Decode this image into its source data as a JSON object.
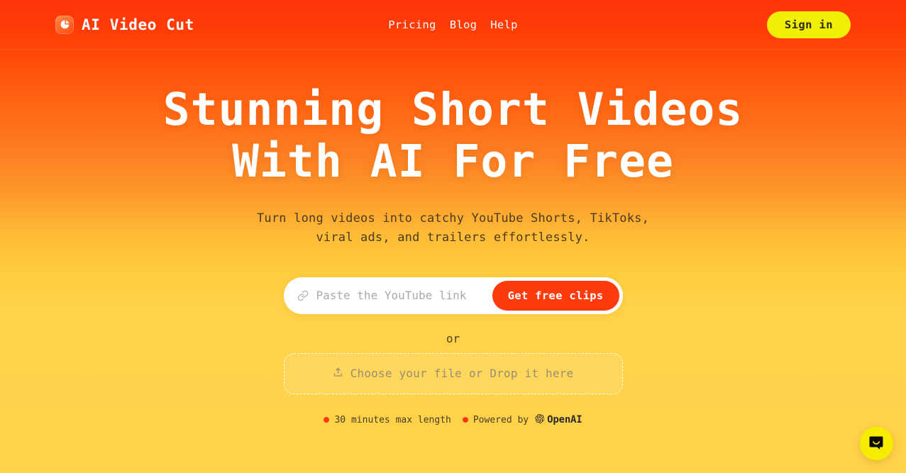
{
  "brand": {
    "name": "AI Video Cut",
    "logo_icon": "pie-chart-logo-icon"
  },
  "nav": {
    "items": [
      {
        "label": "Pricing"
      },
      {
        "label": "Blog"
      },
      {
        "label": "Help"
      }
    ],
    "signin_label": "Sign in"
  },
  "hero": {
    "heading": "Stunning Short Videos\nWith AI For Free",
    "subheading": "Turn long videos into catchy YouTube Shorts, TikToks,\nviral ads, and trailers effortlessly."
  },
  "url_form": {
    "link_icon": "link-icon",
    "placeholder": "Paste the YouTube link",
    "value": "",
    "cta_label": "Get free clips"
  },
  "divider_label": "or",
  "upload": {
    "icon": "upload-icon",
    "label": "Choose your file or Drop it here"
  },
  "meta": {
    "items": [
      {
        "bullet": "red-dot-icon",
        "label": "30 minutes max length"
      },
      {
        "bullet": "red-dot-icon",
        "label": "Powered by"
      }
    ],
    "openai_name": "OpenAI",
    "openai_icon": "openai-logo-icon"
  },
  "chat": {
    "icon": "chat-bubble-smile-icon"
  },
  "colors": {
    "gradient_top": "#ff3409",
    "gradient_bottom": "#ffd24a",
    "accent_red": "#ff3b0e",
    "accent_yellow": "#f2ef07",
    "text_dark": "#4a3c23",
    "white": "#ffffff"
  }
}
